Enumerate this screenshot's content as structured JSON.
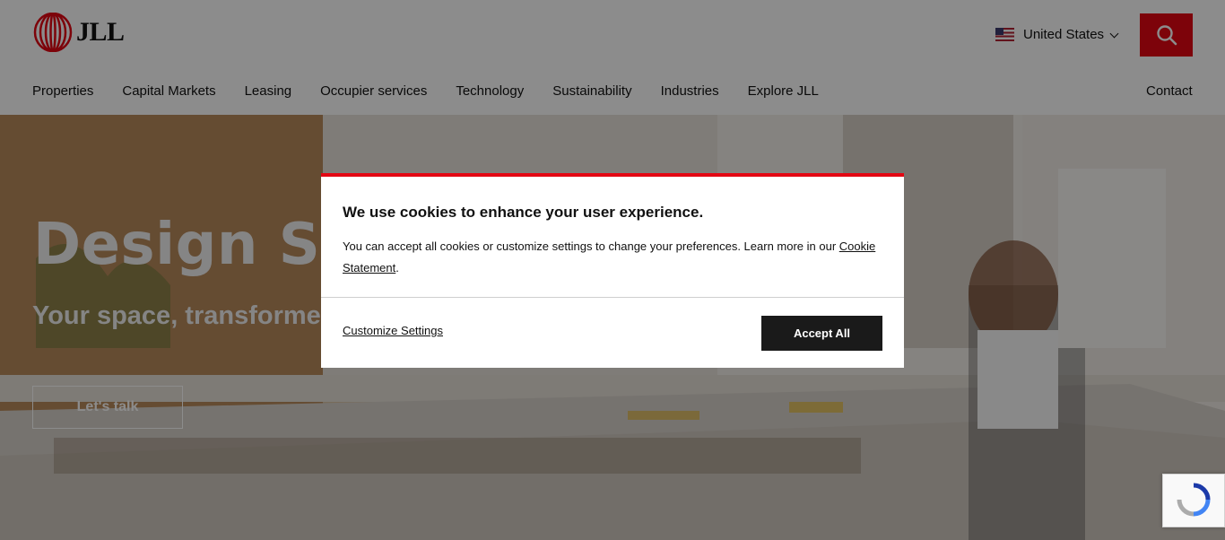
{
  "header": {
    "logo_text": "JLL",
    "country": {
      "flag_icon": "us-flag-icon",
      "label": "United States"
    },
    "search_icon": "search-icon",
    "nav": [
      {
        "label": "Properties"
      },
      {
        "label": "Capital Markets"
      },
      {
        "label": "Leasing"
      },
      {
        "label": "Occupier services"
      },
      {
        "label": "Technology"
      },
      {
        "label": "Sustainability"
      },
      {
        "label": "Industries"
      },
      {
        "label": "Explore JLL"
      }
    ],
    "contact_label": "Contact"
  },
  "hero": {
    "title": "Design Solutions",
    "subtitle": "Your space, transformed",
    "cta_label": "Let's talk"
  },
  "cookie_modal": {
    "title": "We use cookies to enhance your user experience.",
    "text_before_link": "You can accept all cookies or customize settings to change your preferences. Learn more in our ",
    "link_label": "Cookie Statement",
    "text_after_link": ".",
    "customize_label": "Customize Settings",
    "accept_label": "Accept All"
  },
  "colors": {
    "brand_red": "#e30613",
    "accept_button": "#1a1a1a"
  }
}
